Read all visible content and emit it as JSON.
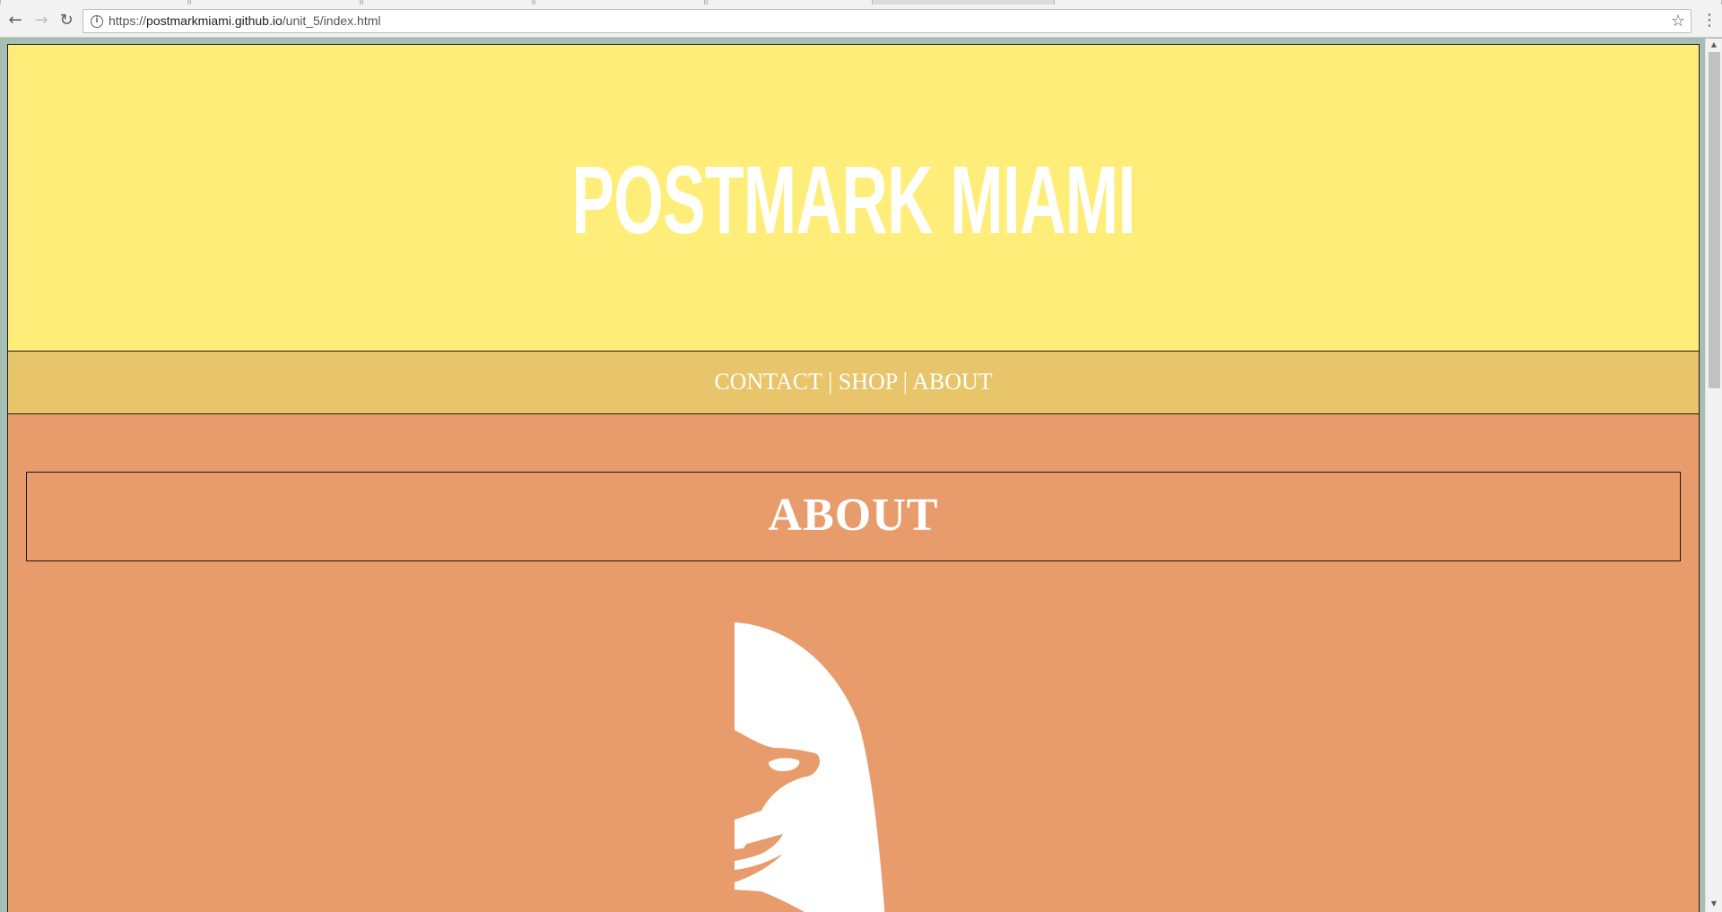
{
  "browser": {
    "url_prefix": "https://",
    "url_host": "postmarkmiami.github.io",
    "url_path": "/unit_5/index.html",
    "back_icon": "←",
    "forward_icon": "→",
    "reload_icon": "↻",
    "info_icon": "i",
    "bookmark_icon": "☆",
    "menu_icon": "⋮"
  },
  "site": {
    "title": "POSTMARK MIAMI",
    "nav": {
      "contact": "CONTACT",
      "shop": "SHOP",
      "about": "ABOUT",
      "separator": "|"
    },
    "about_heading": "ABOUT"
  },
  "colors": {
    "header_bg": "#ffed79",
    "nav_bg": "#e8c56b",
    "main_bg": "#e89b6b",
    "text": "#ffffff"
  },
  "scrollbar": {
    "up_icon": "▲",
    "down_icon": "▼"
  }
}
